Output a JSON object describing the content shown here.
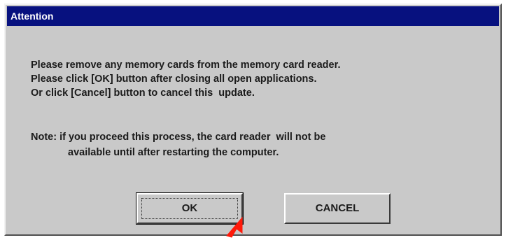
{
  "dialog": {
    "title": "Attention",
    "message_lines": [
      "Please remove any memory cards from the memory card reader.",
      "Please click [OK] button after closing all open applications.",
      "Or click [Cancel] button to cancel this  update."
    ],
    "note_lines": [
      "Note: if you proceed this process, the card reader  will not be",
      "available until after restarting the computer."
    ],
    "buttons": {
      "ok_label": "OK",
      "cancel_label": "CANCEL"
    }
  },
  "colors": {
    "titlebar": "#07117f",
    "dialog_bg": "#c9c9c9",
    "cursor": "#ff0000"
  },
  "icons": {
    "cursor": "red-arrow-cursor-icon"
  }
}
